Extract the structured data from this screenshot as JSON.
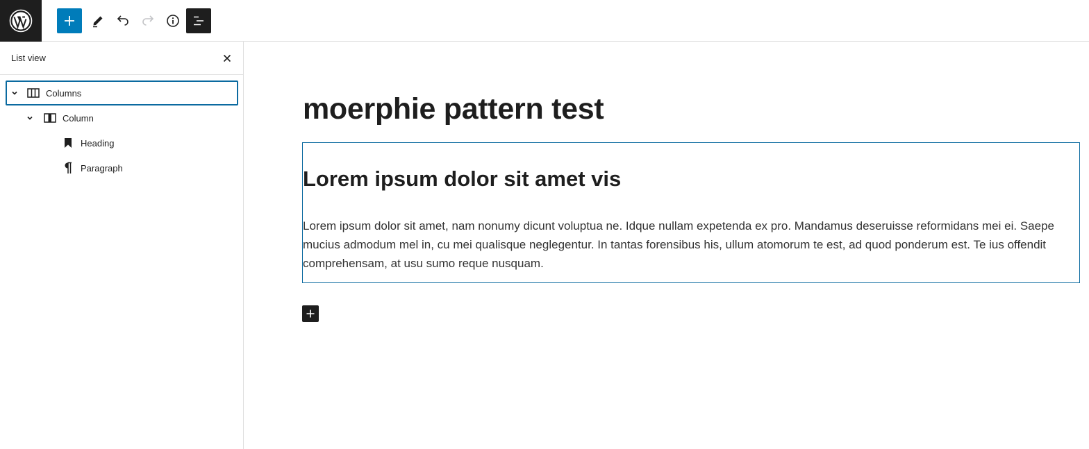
{
  "toolbar": {
    "logo_icon": "wordpress-logo-icon",
    "buttons": [
      {
        "name": "add-block",
        "icon": "plus-icon",
        "active": true,
        "accent": "#007cba"
      },
      {
        "name": "tools",
        "icon": "pencil-icon"
      },
      {
        "name": "undo",
        "icon": "undo-icon"
      },
      {
        "name": "redo",
        "icon": "redo-icon",
        "disabled": true
      },
      {
        "name": "details",
        "icon": "info-icon"
      },
      {
        "name": "list-view",
        "icon": "list-view-icon",
        "active": true
      }
    ]
  },
  "sidebar": {
    "title": "List view",
    "items": [
      {
        "label": "Columns",
        "icon": "columns-icon",
        "expanded": true,
        "selected": true,
        "level": 1
      },
      {
        "label": "Column",
        "icon": "column-icon",
        "expanded": true,
        "level": 2
      },
      {
        "label": "Heading",
        "icon": "bookmark-icon",
        "level": 3
      },
      {
        "label": "Paragraph",
        "icon": "pilcrow-icon",
        "level": 3
      }
    ]
  },
  "editor": {
    "post_title": "moerphie pattern test",
    "heading": "Lorem ipsum dolor sit amet vis",
    "paragraph": "Lorem ipsum dolor sit amet, nam nonumy dicunt voluptua ne. Idque nullam expetenda ex pro. Mandamus deseruisse reformidans mei ei. Saepe mucius admodum mel in, cu mei qualisque neglegentur. In tantas forensibus his, ullum atomorum te est, ad quod ponderum est. Te ius offendit comprehensam, at usu sumo reque nusquam."
  },
  "colors": {
    "accent": "#007cba",
    "selection": "#0b6aa0",
    "dark": "#1e1e1e"
  }
}
